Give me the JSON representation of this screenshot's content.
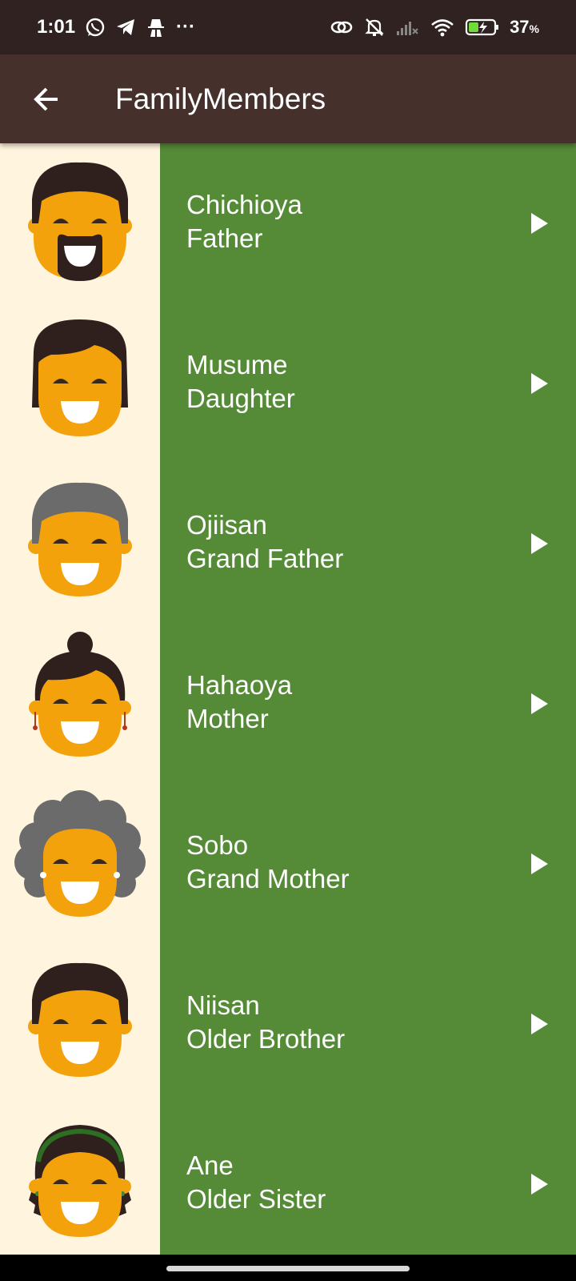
{
  "status_bar": {
    "time": "1:01",
    "more": "···",
    "battery_percent": "37",
    "percent_sign": "%",
    "icons": [
      "whatsapp-icon",
      "telegram-icon",
      "incognito-icon",
      "link-icon",
      "mute-icon",
      "signal-icon",
      "wifi-icon",
      "battery-charging-icon"
    ]
  },
  "app_bar": {
    "title": "FamilyMembers",
    "back_icon": "arrow-left-icon"
  },
  "colors": {
    "status_bar": "#2f2221",
    "app_bar": "#45302c",
    "avatar_background": "#fff5df",
    "content_background": "#558b37",
    "skin": "#f4a20c",
    "dark_hair": "#2f1f1d",
    "gray_hair": "#6b6b6b"
  },
  "members": [
    {
      "japanese": "Chichioya",
      "english": "Father",
      "avatar": "father-avatar",
      "play_icon": "play-icon"
    },
    {
      "japanese": "Musume",
      "english": "Daughter",
      "avatar": "daughter-avatar",
      "play_icon": "play-icon"
    },
    {
      "japanese": "Ojiisan",
      "english": "Grand Father",
      "avatar": "grandfather-avatar",
      "play_icon": "play-icon"
    },
    {
      "japanese": "Hahaoya",
      "english": "Mother",
      "avatar": "mother-avatar",
      "play_icon": "play-icon"
    },
    {
      "japanese": "Sobo",
      "english": "Grand Mother",
      "avatar": "grandmother-avatar",
      "play_icon": "play-icon"
    },
    {
      "japanese": "Niisan",
      "english": "Older Brother",
      "avatar": "older-brother-avatar",
      "play_icon": "play-icon"
    },
    {
      "japanese": "Ane",
      "english": "Older Sister",
      "avatar": "older-sister-avatar",
      "play_icon": "play-icon"
    }
  ]
}
